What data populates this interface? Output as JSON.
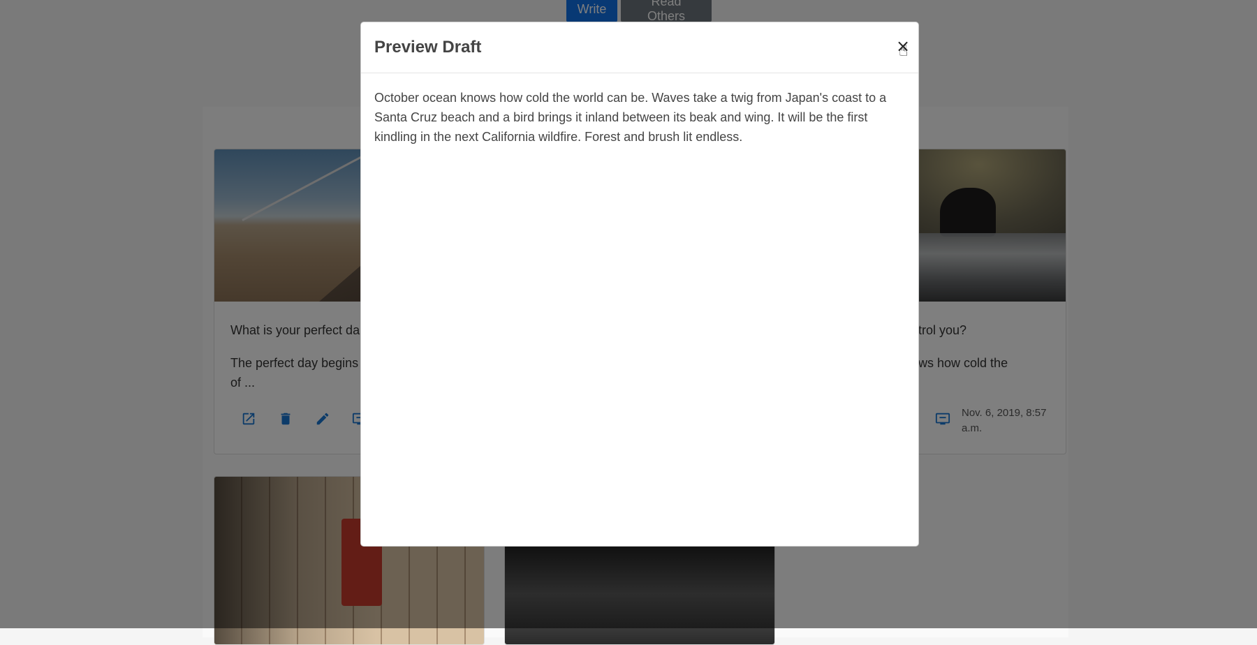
{
  "nav": {
    "write_label": "Write",
    "read_label": "Read Others"
  },
  "cards": {
    "c1": {
      "question": "What is your perfect da",
      "text": "The perfect day begins\nof ...",
      "icons": [
        "open-in-new-icon",
        "delete-icon",
        "edit-icon",
        "present-icon"
      ]
    },
    "c3": {
      "question": "ntrol you?",
      "text": "ows how cold the",
      "date": "Nov. 6, 2019, 8:57 a.m.",
      "icon": "present-icon"
    }
  },
  "modal": {
    "title": "Preview Draft",
    "close_label": "×",
    "body": "October ocean knows how cold the world can be. Waves take a twig from Japan's coast to a Santa Cruz beach and a bird brings it inland between its beak and wing. It will be the first kindling in the next California wildfire. Forest and brush lit endless."
  },
  "colors": {
    "accent": "#1173e8",
    "secondary": "#6c757d",
    "icon": "#1976d2"
  }
}
